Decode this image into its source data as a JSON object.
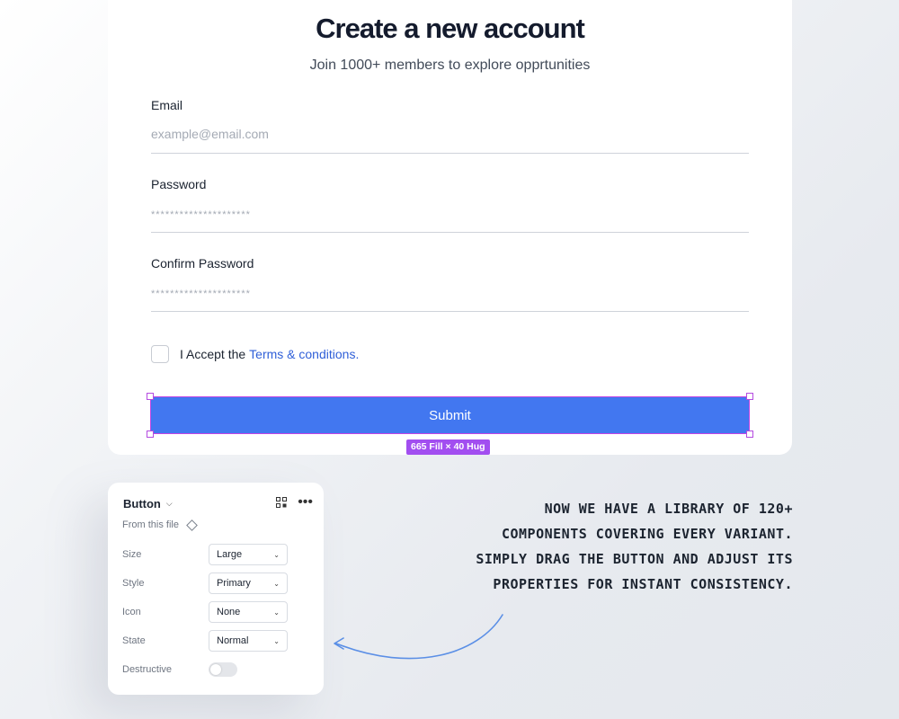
{
  "form": {
    "title": "Create a new account",
    "subtitle": "Join 1000+ members to explore opprtunities",
    "email": {
      "label": "Email",
      "placeholder": "example@email.com"
    },
    "password": {
      "label": "Password",
      "placeholder": "*********************"
    },
    "confirm_password": {
      "label": "Confirm Password",
      "placeholder": "*********************"
    },
    "terms": {
      "text": "I Accept the",
      "link": "Terms & conditions."
    },
    "submit_label": "Submit",
    "size_badge": "665 Fill × 40 Hug"
  },
  "panel": {
    "title": "Button",
    "from_file": "From this file",
    "properties": [
      {
        "label": "Size",
        "value": "Large"
      },
      {
        "label": "Style",
        "value": "Primary"
      },
      {
        "label": "Icon",
        "value": "None"
      },
      {
        "label": "State",
        "value": "Normal"
      }
    ],
    "destructive_label": "Destructive",
    "destructive_on": false
  },
  "annotation": {
    "lines": [
      "NOW WE HAVE A LIBRARY OF 120+",
      "COMPONENTS COVERING EVERY VARIANT.",
      "SIMPLY DRAG THE BUTTON AND ADJUST ITS",
      "PROPERTIES FOR INSTANT CONSISTENCY."
    ]
  },
  "colors": {
    "primary_button": "#4277f0",
    "link": "#2f5fd8",
    "selection": "#a24ef0",
    "arrow": "#5b8fe6"
  }
}
